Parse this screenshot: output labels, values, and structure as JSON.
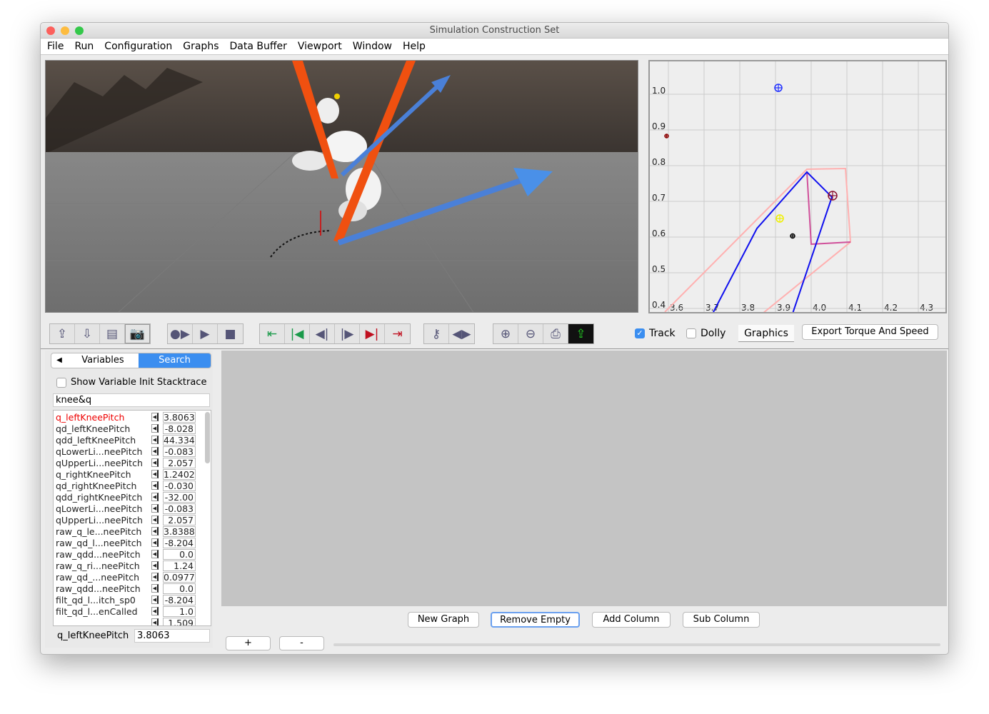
{
  "window": {
    "title": "Simulation Construction Set"
  },
  "menu": [
    "File",
    "Run",
    "Configuration",
    "Graphs",
    "Data Buffer",
    "Viewport",
    "Window",
    "Help"
  ],
  "toolbar": {
    "icons": [
      "export-icon",
      "import-icon",
      "film-icon",
      "camera-icon",
      "simulate-icon",
      "play-icon",
      "stop-icon",
      "goto-in-point-icon",
      "set-in-point-icon",
      "step-backward-icon",
      "step-forward-icon",
      "set-out-point-icon",
      "goto-out-point-icon",
      "key-icon",
      "toggle-keypoints-icon",
      "zoom-in-icon",
      "zoom-out-icon",
      "print-icon",
      "export-graph-icon"
    ],
    "track_label": "Track",
    "track_checked": true,
    "dolly_label": "Dolly",
    "dolly_checked": false,
    "graphics_label": "Graphics",
    "export_label": "Export Torque And Speed"
  },
  "plot": {
    "x_ticks": [
      "3.6",
      "3.7",
      "3.8",
      "3.9",
      "4.0",
      "4.1",
      "4.2",
      "4.3"
    ],
    "y_ticks": [
      "0.4",
      "0.5",
      "0.6",
      "0.7",
      "0.8",
      "0.9",
      "1.0"
    ],
    "lines": [
      {
        "color": "#ffb0b0",
        "points": [
          [
            3.59,
            0.39
          ],
          [
            3.988,
            0.79
          ],
          [
            4.096,
            0.792
          ],
          [
            4.11,
            0.586
          ],
          [
            3.864,
            0.386
          ]
        ]
      },
      {
        "color": "#d0509a",
        "points": [
          [
            3.988,
            0.782
          ],
          [
            4.0,
            0.58
          ],
          [
            4.11,
            0.586
          ]
        ]
      },
      {
        "color": "#1010ee",
        "points": [
          [
            3.724,
            0.386
          ],
          [
            3.848,
            0.624
          ],
          [
            3.988,
            0.782
          ],
          [
            4.058,
            0.712
          ],
          [
            3.948,
            0.386
          ]
        ]
      }
    ],
    "markers": [
      {
        "x": 3.908,
        "y": 1.018,
        "color": "#2030ff",
        "size": 5
      },
      {
        "x": 3.595,
        "y": 0.883,
        "color": "#8b0000",
        "size": 2.5
      },
      {
        "x": 4.06,
        "y": 0.716,
        "color": "#8b1030",
        "size": 6
      },
      {
        "x": 3.912,
        "y": 0.652,
        "color": "#f0f000",
        "size": 5
      },
      {
        "x": 3.948,
        "y": 0.603,
        "color": "#000000",
        "size": 3
      }
    ]
  },
  "variables": {
    "tabs": [
      "Variables",
      "Search"
    ],
    "active_tab": "Search",
    "stacktrace_label": "Show Variable Init Stacktrace",
    "search_value": "knee&q",
    "rows": [
      {
        "name": "q_leftKneePitch",
        "value": "3.8063",
        "selected": true
      },
      {
        "name": "qd_leftKneePitch",
        "value": "-8.028"
      },
      {
        "name": "qdd_leftKneePitch",
        "value": "44.334"
      },
      {
        "name": "qLowerLi...neePitch",
        "value": "-0.083"
      },
      {
        "name": "qUpperLi...neePitch",
        "value": "2.057"
      },
      {
        "name": "q_rightKneePitch",
        "value": "1.2402"
      },
      {
        "name": "qd_rightKneePitch",
        "value": "-0.030"
      },
      {
        "name": "qdd_rightKneePitch",
        "value": "-32.00"
      },
      {
        "name": "qLowerLi...neePitch",
        "value": "-0.083"
      },
      {
        "name": "qUpperLi...neePitch",
        "value": "2.057"
      },
      {
        "name": "raw_q_le...neePitch",
        "value": "3.8388"
      },
      {
        "name": "raw_qd_l...neePitch",
        "value": "-8.204"
      },
      {
        "name": "raw_qdd...neePitch",
        "value": "0.0"
      },
      {
        "name": "raw_q_ri...neePitch",
        "value": "1.24"
      },
      {
        "name": "raw_qd_...neePitch",
        "value": "0.0977"
      },
      {
        "name": "raw_qdd...neePitch",
        "value": "0.0"
      },
      {
        "name": "filt_qd_l...itch_sp0",
        "value": "-8.204"
      },
      {
        "name": "filt_qd_l...enCalled",
        "value": "1.0"
      },
      {
        "name": "",
        "value": "1.509"
      }
    ],
    "selected_name": "q_leftKneePitch",
    "selected_value": "3.8063"
  },
  "graph_buttons": {
    "new": "New Graph",
    "remove": "Remove Empty",
    "add_col": "Add Column",
    "sub_col": "Sub Column",
    "plus": "+",
    "minus": "-"
  }
}
